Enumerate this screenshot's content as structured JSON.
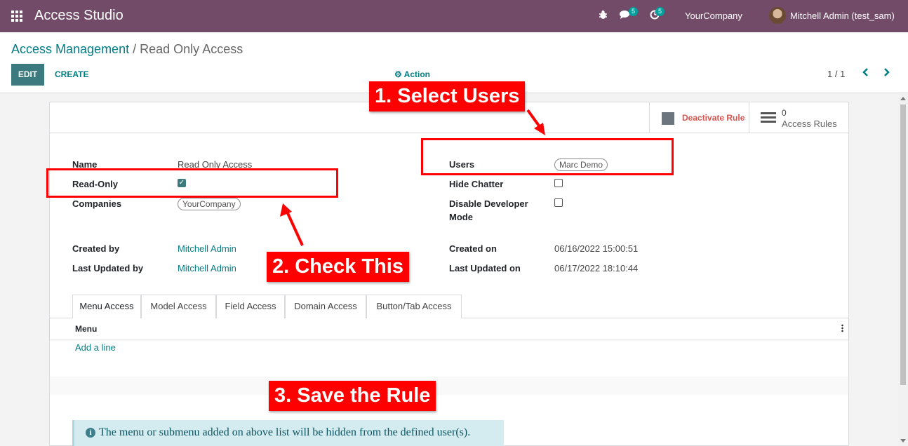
{
  "navbar": {
    "app_title": "Access Studio",
    "chat_badge": "5",
    "activity_badge": "5",
    "company": "YourCompany",
    "user": "Mitchell Admin (test_sam)",
    "color": "#714b67"
  },
  "breadcrumb": {
    "parent": "Access Management",
    "separator": "/",
    "current": "Read Only Access"
  },
  "toolbar": {
    "edit_label": "EDIT",
    "create_label": "CREATE",
    "action_label": "Action",
    "pager": "1 / 1",
    "prev_icon": "‹",
    "next_icon": "›"
  },
  "smart_buttons": {
    "deactivate_label": "Deactivate Rule",
    "access_rules_count": "0",
    "access_rules_label": "Access Rules"
  },
  "form": {
    "name_label": "Name",
    "name_value": "Read Only Access",
    "readonly_label": "Read-Only",
    "readonly_checked": true,
    "companies_label": "Companies",
    "companies_tag": "YourCompany",
    "users_label": "Users",
    "users_tag": "Marc Demo",
    "hide_chatter_label": "Hide Chatter",
    "hide_chatter_checked": false,
    "disable_dev_label_1": "Disable Developer",
    "disable_dev_label_2": "Mode",
    "disable_dev_checked": false,
    "created_by_label": "Created by",
    "created_by_value": "Mitchell Admin",
    "last_updated_by_label": "Last Updated by",
    "last_updated_by_value": "Mitchell Admin",
    "created_on_label": "Created on",
    "created_on_value": "06/16/2022 15:00:51",
    "last_updated_on_label": "Last Updated on",
    "last_updated_on_value": "06/17/2022 18:10:44"
  },
  "tabs": [
    {
      "label": "Menu Access",
      "active": true
    },
    {
      "label": "Model Access",
      "active": false
    },
    {
      "label": "Field Access",
      "active": false
    },
    {
      "label": "Domain Access",
      "active": false
    },
    {
      "label": "Button/Tab Access",
      "active": false
    }
  ],
  "menu_list": {
    "column_header": "Menu",
    "add_line": "Add a line"
  },
  "info": {
    "icon": "i",
    "text": "The menu or submenu added on above list will be hidden from the defined user(s)."
  },
  "annotations": {
    "step1": "1. Select Users",
    "step2": "2. Check This",
    "step3": "3. Save the Rule",
    "color": "#ff0000"
  }
}
